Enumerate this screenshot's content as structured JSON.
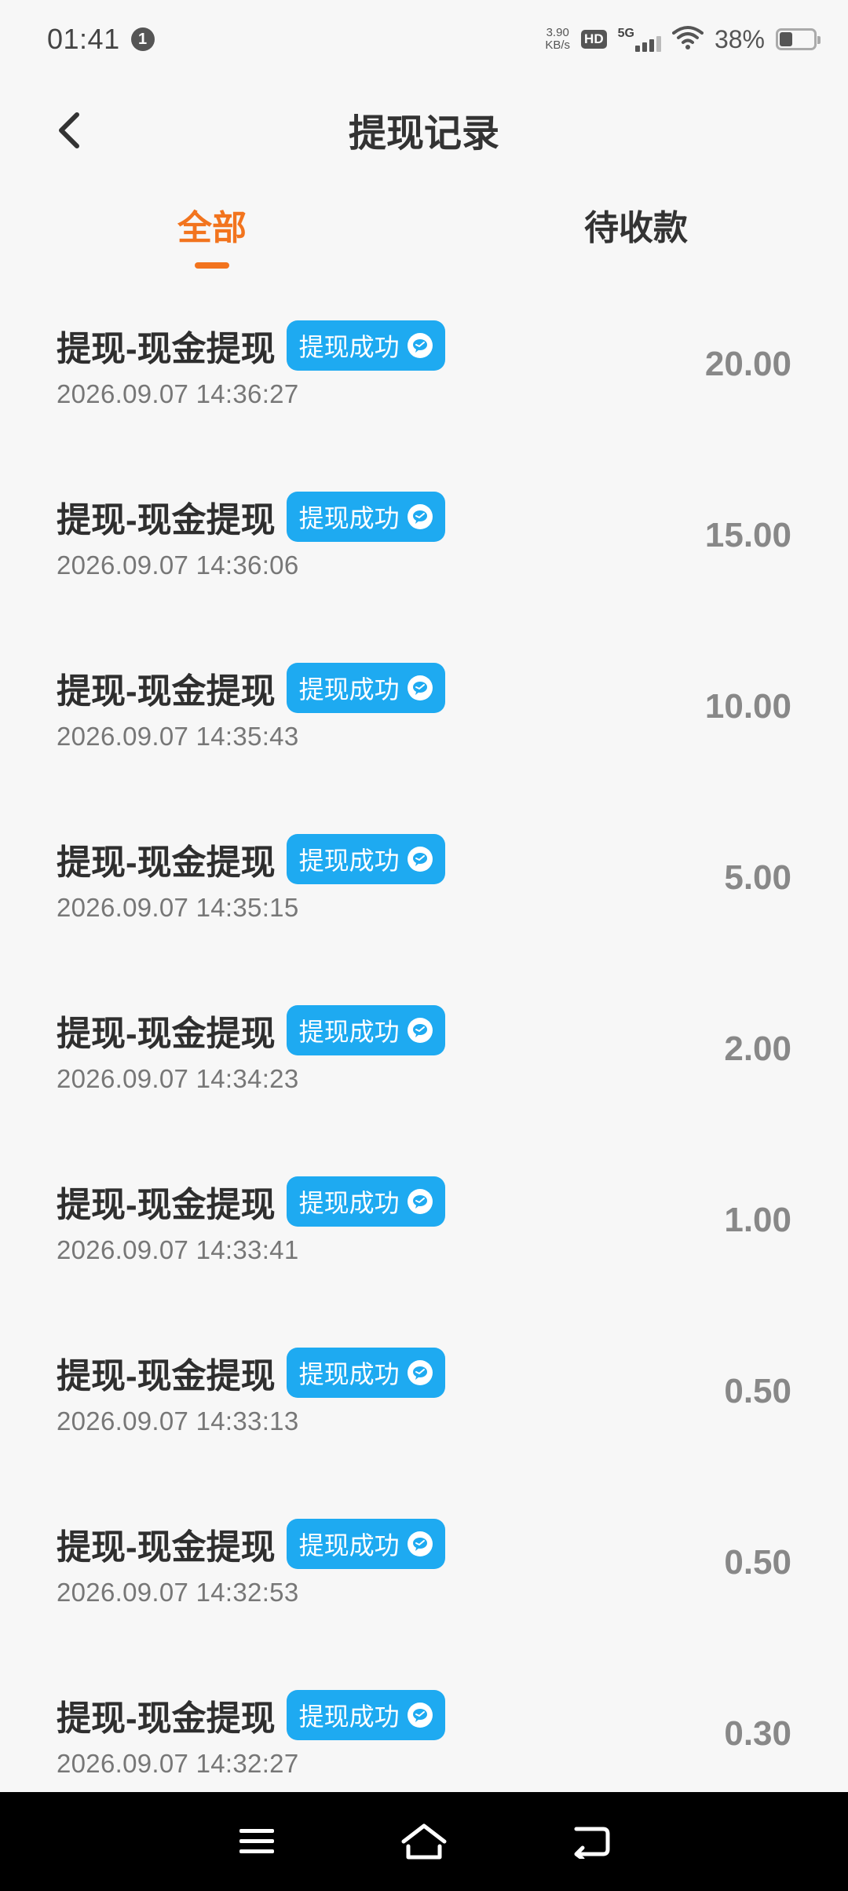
{
  "status_bar": {
    "time": "01:41",
    "notification_count": "1",
    "net_speed_value": "3.90",
    "net_speed_unit": "KB/s",
    "hd_label": "HD",
    "network_label": "5G",
    "battery_percent_text": "38%",
    "battery_level": 0.38
  },
  "header": {
    "title": "提现记录"
  },
  "tabs": [
    {
      "label": "全部",
      "active": true
    },
    {
      "label": "待收款",
      "active": false
    }
  ],
  "records": [
    {
      "title": "提现-现金提现",
      "status": "提现成功",
      "time": "2026.09.07 14:36:27",
      "amount": "20.00"
    },
    {
      "title": "提现-现金提现",
      "status": "提现成功",
      "time": "2026.09.07 14:36:06",
      "amount": "15.00"
    },
    {
      "title": "提现-现金提现",
      "status": "提现成功",
      "time": "2026.09.07 14:35:43",
      "amount": "10.00"
    },
    {
      "title": "提现-现金提现",
      "status": "提现成功",
      "time": "2026.09.07 14:35:15",
      "amount": "5.00"
    },
    {
      "title": "提现-现金提现",
      "status": "提现成功",
      "time": "2026.09.07 14:34:23",
      "amount": "2.00"
    },
    {
      "title": "提现-现金提现",
      "status": "提现成功",
      "time": "2026.09.07 14:33:41",
      "amount": "1.00"
    },
    {
      "title": "提现-现金提现",
      "status": "提现成功",
      "time": "2026.09.07 14:33:13",
      "amount": "0.50"
    },
    {
      "title": "提现-现金提现",
      "status": "提现成功",
      "time": "2026.09.07 14:32:53",
      "amount": "0.50"
    },
    {
      "title": "提现-现金提现",
      "status": "提现成功",
      "time": "2026.09.07 14:32:27",
      "amount": "0.30"
    }
  ],
  "colors": {
    "accent": "#f2741e",
    "badge": "#1eaaf1",
    "background": "#f7f7f7"
  },
  "icons": {
    "back": "chevron-left-icon",
    "badge": "wechat-icon",
    "nav_menu": "menu-icon",
    "nav_home": "home-icon",
    "nav_back": "back-icon"
  }
}
